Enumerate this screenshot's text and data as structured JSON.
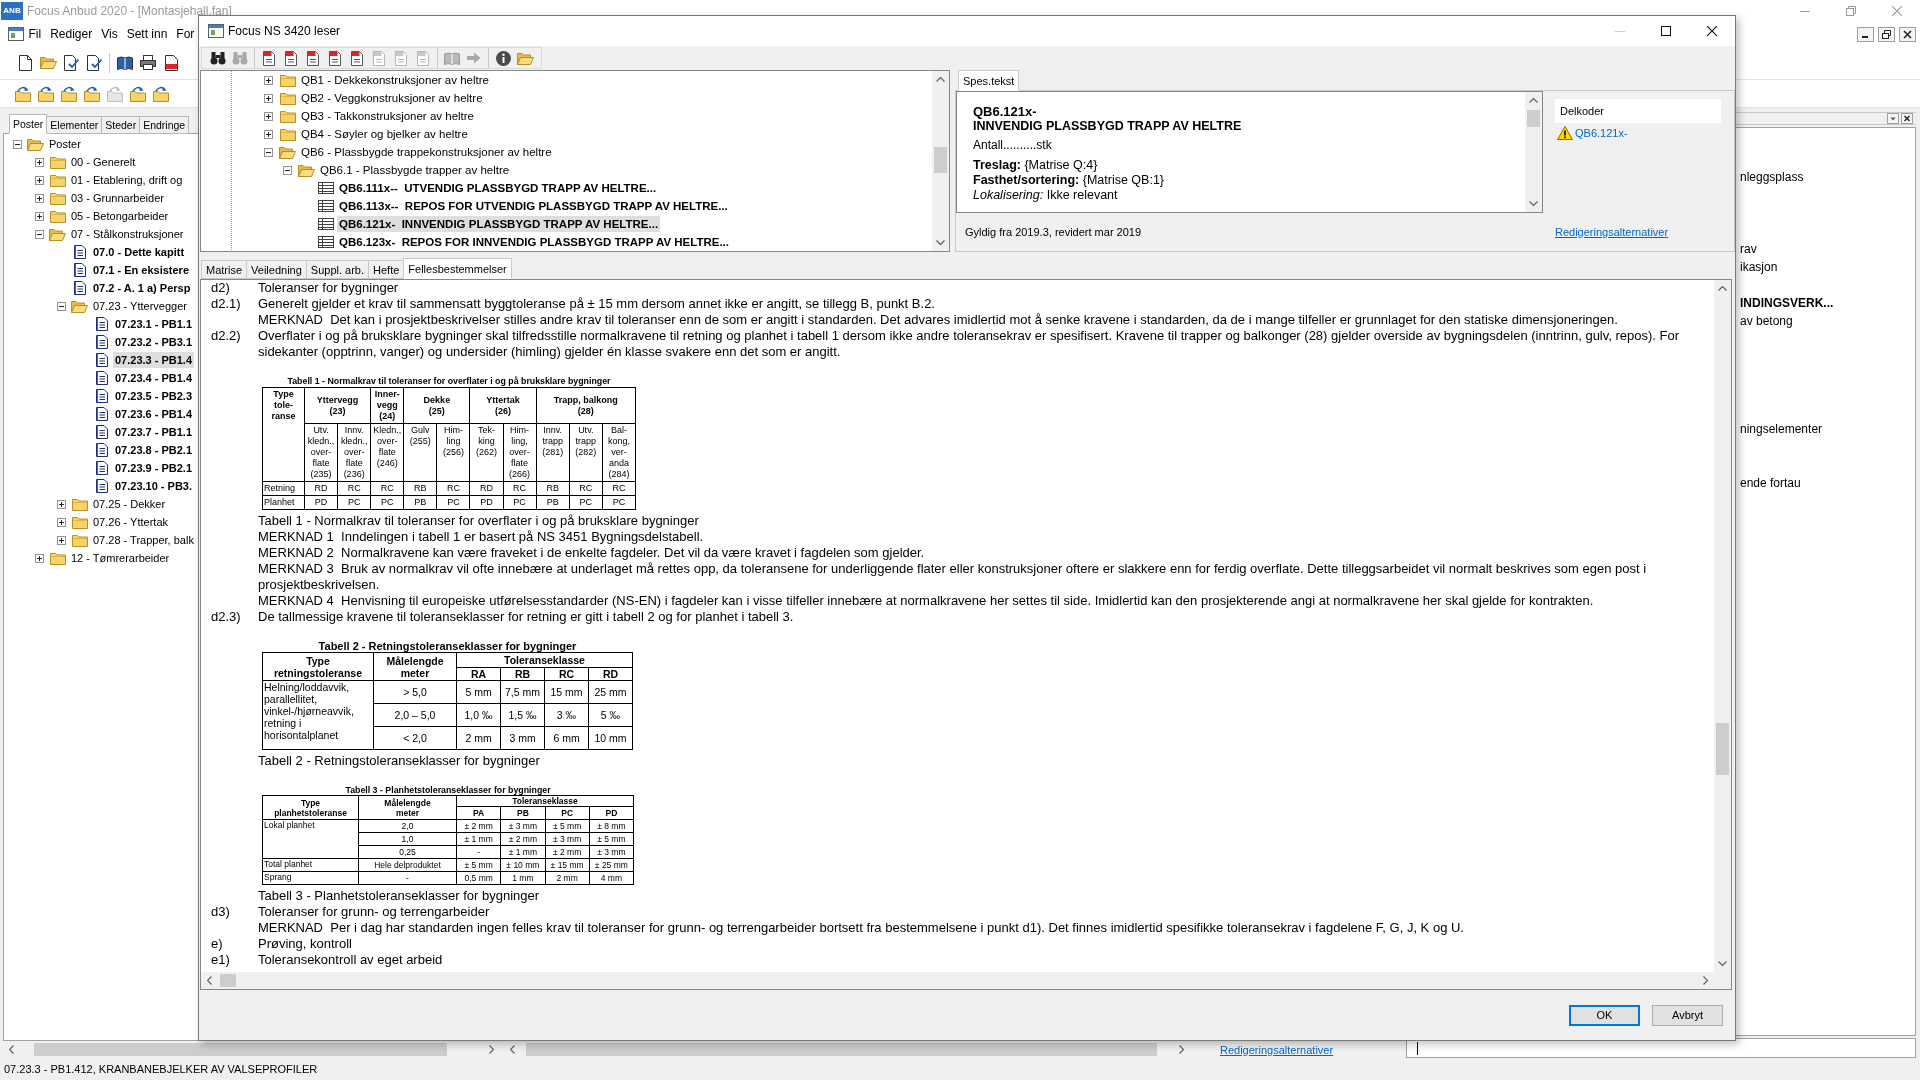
{
  "app": {
    "logo": "ANB",
    "title": "Focus Anbud 2020 - [Montasjehall.fan]",
    "menu": [
      "Fil",
      "Rediger",
      "Vis",
      "Sett inn",
      "For"
    ],
    "toolbars": [
      [
        [
          {
            "kind": "new",
            "disabled": false
          },
          {
            "kind": "open",
            "disabled": false
          },
          {
            "kind": "properties",
            "disabled": false
          },
          {
            "kind": "properties",
            "disabled": false
          }
        ],
        [
          {
            "kind": "book",
            "disabled": false
          },
          {
            "kind": "print",
            "disabled": false
          },
          {
            "kind": "pdf",
            "disabled": false
          }
        ]
      ],
      [
        [
          {
            "kind": "insert",
            "disabled": false
          },
          {
            "kind": "insert",
            "disabled": false
          },
          {
            "kind": "insert",
            "disabled": false
          },
          {
            "kind": "insert",
            "disabled": false
          },
          {
            "kind": "insert",
            "disabled": true
          },
          {
            "kind": "insert",
            "disabled": false
          },
          {
            "kind": "insert",
            "disabled": false
          }
        ]
      ]
    ],
    "panel_tabs": [
      {
        "label": "Poster",
        "selected": true
      },
      {
        "label": "Elementer",
        "selected": false
      },
      {
        "label": "Steder",
        "selected": false
      },
      {
        "label": "Endringe",
        "selected": false
      }
    ],
    "tree": [
      {
        "kind": "folder",
        "label": "Poster",
        "expanded": true,
        "selected": false,
        "children": [
          {
            "kind": "folder",
            "label": "00 - Generelt",
            "expanded": false,
            "selected": false
          },
          {
            "kind": "folder",
            "label": "01 - Etablering, drift og",
            "expanded": false,
            "selected": false
          },
          {
            "kind": "folder",
            "label": "03 - Grunnarbeider",
            "expanded": false,
            "selected": false
          },
          {
            "kind": "folder",
            "label": "05 - Betongarbeider",
            "expanded": false,
            "selected": false
          },
          {
            "kind": "folder",
            "label": "07 - Stålkonstruksjoner",
            "expanded": true,
            "selected": false,
            "children": [
              {
                "kind": "document",
                "label": "07.0 - Dette kapitt",
                "selected": false
              },
              {
                "kind": "document",
                "label": "07.1 - En eksistere",
                "selected": false
              },
              {
                "kind": "document",
                "label": "07.2 - A. 1 a) Persp",
                "selected": false
              },
              {
                "kind": "folder",
                "label": "07.23 - Yttervegger",
                "expanded": true,
                "selected": false,
                "children": [
                  {
                    "kind": "document",
                    "label": "07.23.1 - PB1.1",
                    "selected": false
                  },
                  {
                    "kind": "document",
                    "label": "07.23.2 - PB3.1",
                    "selected": false
                  },
                  {
                    "kind": "document",
                    "label": "07.23.3 - PB1.4",
                    "selected": true
                  },
                  {
                    "kind": "document",
                    "label": "07.23.4 - PB1.4",
                    "selected": false
                  },
                  {
                    "kind": "document",
                    "label": "07.23.5 - PB2.3",
                    "selected": false
                  },
                  {
                    "kind": "document",
                    "label": "07.23.6 - PB1.4",
                    "selected": false
                  },
                  {
                    "kind": "document",
                    "label": "07.23.7 - PB1.1",
                    "selected": false
                  },
                  {
                    "kind": "document",
                    "label": "07.23.8 - PB2.1",
                    "selected": false
                  },
                  {
                    "kind": "document",
                    "label": "07.23.9 - PB2.1",
                    "selected": false
                  },
                  {
                    "kind": "document",
                    "label": "07.23.10 - PB3.",
                    "selected": false
                  }
                ]
              },
              {
                "kind": "folder",
                "label": "07.25 - Dekker",
                "expanded": false,
                "selected": false
              },
              {
                "kind": "folder",
                "label": "07.26 - Yttertak",
                "expanded": false,
                "selected": false
              },
              {
                "kind": "folder",
                "label": "07.28 - Trapper, balk",
                "expanded": false,
                "selected": false
              }
            ]
          },
          {
            "kind": "folder",
            "label": "12 - Tømrerarbeider",
            "expanded": false,
            "selected": false
          }
        ]
      }
    ],
    "link": "Redigeringsalternativer",
    "side_list": [
      {
        "text": "nleggsplass",
        "bold": false
      },
      {
        "text": "rav",
        "bold": false
      },
      {
        "text": "ikasjon",
        "bold": false
      },
      {
        "text": "INDINGSVERK...",
        "bold": true
      },
      {
        "text": "av betong",
        "bold": false
      },
      {
        "text": "ningselementer",
        "bold": false
      },
      {
        "text": "ende fortau",
        "bold": false
      }
    ],
    "status_bar": "07.23.3 - PB1.412, KRANBANEBJELKER AV VALSEPROFILER"
  },
  "dialog": {
    "title": "Focus NS 3420 leser",
    "controls": [
      {
        "kind": "minimize",
        "disabled": true
      },
      {
        "kind": "maximize",
        "disabled": false
      },
      {
        "kind": "close",
        "disabled": false
      }
    ],
    "toolbar": [
      [
        {
          "kind": "find",
          "disabled": false
        },
        {
          "kind": "find",
          "disabled": true
        }
      ],
      [
        {
          "kind": "page",
          "disabled": false
        },
        {
          "kind": "page",
          "disabled": false
        },
        {
          "kind": "page",
          "disabled": false
        },
        {
          "kind": "page",
          "disabled": false
        },
        {
          "kind": "page",
          "disabled": false
        },
        {
          "kind": "page",
          "disabled": true
        },
        {
          "kind": "page",
          "disabled": true
        },
        {
          "kind": "page",
          "disabled": true
        }
      ],
      [
        {
          "kind": "book",
          "disabled": true
        },
        {
          "kind": "forward",
          "disabled": true
        }
      ],
      [
        {
          "kind": "info",
          "disabled": false
        },
        {
          "kind": "open",
          "disabled": false
        }
      ]
    ],
    "tree": [
      {
        "kind": "folder",
        "label": "QB1 - Dekkekonstruksjoner av heltre",
        "expanded": false,
        "selected": false
      },
      {
        "kind": "folder",
        "label": "QB2 - Veggkonstruksjoner av heltre",
        "expanded": false,
        "selected": false
      },
      {
        "kind": "folder",
        "label": "QB3 - Takkonstruksjoner av heltre",
        "expanded": false,
        "selected": false
      },
      {
        "kind": "folder",
        "label": "QB4 - Søyler og bjelker av heltre",
        "expanded": false,
        "selected": false
      },
      {
        "kind": "folder",
        "label": "QB6 - Plassbygde trappekonstruksjoner av heltre",
        "expanded": true,
        "selected": false,
        "children": [
          {
            "kind": "folder",
            "label": "QB6.1 - Plassbygde trapper av heltre",
            "expanded": true,
            "selected": false,
            "children": [
              {
                "kind": "entry",
                "label": "QB6.111x--  UTVENDIG PLASSBYGD TRAPP AV HELTRE...",
                "selected": false
              },
              {
                "kind": "entry",
                "label": "QB6.113x--  REPOS FOR UTVENDIG PLASSBYGD TRAPP AV HELTRE...",
                "selected": false
              },
              {
                "kind": "entry",
                "label": "QB6.121x-  INNVENDIG PLASSBYGD TRAPP AV HELTRE...",
                "selected": true
              },
              {
                "kind": "entry",
                "label": "QB6.123x-  REPOS FOR INNVENDIG PLASSBYGD TRAPP AV HELTRE...",
                "selected": false
              }
            ]
          }
        ]
      }
    ],
    "spec": {
      "tabs": [
        {
          "label": "Spes.tekst",
          "selected": true
        }
      ],
      "lines": [
        {
          "kind": "code",
          "text": "QB6.121x-"
        },
        {
          "kind": "heading",
          "text": "INNVENDIG PLASSBYGD TRAPP AV HELTRE"
        },
        {
          "kind": "text",
          "text": "Antall..........stk"
        },
        {
          "kind": "field",
          "text": "**Treslag:** {Matrise Q:4}"
        },
        {
          "kind": "field",
          "text": "**Fasthet/sortering:** {Matrise QB:1}"
        },
        {
          "kind": "field",
          "text": "*Lokalisering:* Ikke relevant"
        }
      ],
      "validity": "Gyldig fra 2019.3, revidert mar 2019",
      "link": "Redigeringsalternativer",
      "subcodes": {
        "title": "Delkoder",
        "items": [
          "QB6.121x-"
        ]
      }
    },
    "tabs": [
      {
        "label": "Matrise",
        "selected": false
      },
      {
        "label": "Veiledning",
        "selected": false
      },
      {
        "label": "Suppl. arb.",
        "selected": false
      },
      {
        "label": "Hefte",
        "selected": false
      },
      {
        "label": "Fellesbestemmelser",
        "selected": true
      }
    ],
    "content": [
      {
        "kind": "clause",
        "label": "d2)",
        "text": "Toleranser for bygninger"
      },
      {
        "kind": "clause",
        "label": "d2.1)",
        "text": "Generelt gjelder et krav til sammensatt byggtoleranse på ± 15 mm dersom annet ikke er angitt, se tillegg B, punkt B.2."
      },
      {
        "kind": "clause",
        "text": "MERKNAD  Det kan i prosjektbeskrivelser stilles andre krav til toleranser enn de som er angitt i standarden. Det advares imidlertid mot å senke kravene i standarden, da de i mange tilfeller er grunnlaget for den statiske dimensjoneringen."
      },
      {
        "kind": "clause",
        "label": "d2.2)",
        "text": "Overflater i og på bruksklare bygninger skal tilfredsstille normalkravene til retning og planhet i tabell 1 dersom ikke andre toleransekrav er spesifisert. Kravene til trapper og balkonger (28) gjelder overside av bygningsdelen (inntrinn, gulv, repos). For sidekanter (opptrinn, vanger) og undersider (himling) gjelder én klasse svakere enn det som er angitt."
      },
      {
        "kind": "matrix",
        "title": "Tabell 1 - Normalkrav til toleranser for overflater i og på bruksklare bygninger",
        "corner": "Type\ntole-\nranse",
        "groups": [
          {
            "label": "Yttervegg\n(23)",
            "columns": [
              "Utv.\nkledn.,\nover-\nflate\n(235)",
              "Innv.\nkledn.,\nover-\nflate\n(236)"
            ]
          },
          {
            "label": "Inner-\nvegg\n(24)",
            "columns": [
              "Kledn.,\nover-\nflate\n(246)"
            ]
          },
          {
            "label": "Dekke\n(25)",
            "columns": [
              "Gulv\n(255)",
              "Him-\nling\n(256)"
            ]
          },
          {
            "label": "Yttertak\n(26)",
            "columns": [
              "Tek-\nking\n(262)",
              "Him-\nling,\nover-\nflate\n(266)"
            ]
          },
          {
            "label": "Trapp, balkong\n(28)",
            "columns": [
              "Innv.\ntrapp\n(281)",
              "Utv.\ntrapp\n(282)",
              "Bal-\nkong,\nver-\nanda\n(284)"
            ]
          }
        ],
        "rows": [
          {
            "label": "Retning",
            "cells": [
              "RD",
              "RC",
              "RC",
              "RB",
              "RC",
              "RD",
              "RC",
              "RB",
              "RC",
              "RC"
            ]
          },
          {
            "label": "Planhet",
            "cells": [
              "PD",
              "PC",
              "PC",
              "PB",
              "PC",
              "PD",
              "PC",
              "PB",
              "PC",
              "PC"
            ]
          }
        ]
      },
      {
        "kind": "clause",
        "text": "Tabell 1 - Normalkrav til toleranser for overflater i og på bruksklare bygninger"
      },
      {
        "kind": "clause",
        "text": "MERKNAD 1  Inndelingen i tabell 1 er basert på NS 3451 Bygningsdelstabell."
      },
      {
        "kind": "clause",
        "text": "MERKNAD 2  Normalkravene kan være fraveket i de enkelte fagdeler. Det vil da være kravet i fagdelen som gjelder."
      },
      {
        "kind": "clause",
        "text": "MERKNAD 3  Bruk av normalkrav vil ofte innebære at underlaget må rettes opp, da toleransene for underliggende flater eller konstruksjoner oftere er slakkere enn for ferdig overflate. Dette tilleggsarbeidet vil normalt beskrives som egen post i prosjektbeskrivelsen."
      },
      {
        "kind": "clause",
        "text": "MERKNAD 4  Henvisning til europeiske utførelsesstandarder (NS-EN) i fagdeler kan i visse tilfeller innebære at normalkravene her settes til side. Imidlertid kan den prosjekterende angi at normalkravene her skal gjelde for kontrakten."
      },
      {
        "kind": "clause",
        "label": "d2.3)",
        "text": "De tallmessige kravene til toleranseklasser for retning er gitt i tabell 2 og for planhet i tabell 3."
      },
      {
        "kind": "classes",
        "title": "Tabell 2 - Retningstoleranseklasser for bygninger",
        "head": [
          "Type\nretningstoleranse",
          "Målelengde\nmeter"
        ],
        "group": {
          "label": "Toleranseklasse",
          "columns": [
            "RA",
            "RB",
            "RC",
            "RD"
          ]
        },
        "sections": [
          {
            "type": "Helning/loddavvik,\nparallellitet,\nvinkel-/hjørneavvik,\nretning i\nhorisontalplanet",
            "rows": [
              {
                "length": "> 5,0",
                "cells": [
                  "5 mm",
                  "7,5 mm",
                  "15 mm",
                  "25 mm"
                ]
              },
              {
                "length": "2,0 – 5,0",
                "cells": [
                  "1,0 ‰",
                  "1,5 ‰",
                  "3 ‰",
                  "5 ‰"
                ]
              },
              {
                "length": "< 2,0",
                "cells": [
                  "2 mm",
                  "3 mm",
                  "6 mm",
                  "10 mm"
                ]
              }
            ]
          }
        ]
      },
      {
        "kind": "clause",
        "text": "Tabell 2 - Retningstoleranseklasser for bygninger"
      },
      {
        "kind": "compact",
        "title": "Tabell 3 - Planhetstoleranseklasser for bygninger",
        "head": [
          "Type\nplanhetstoleranse",
          "Målelengde\nmeter"
        ],
        "group": {
          "label": "Toleranseklasse",
          "columns": [
            "PA",
            "PB",
            "PC",
            "PD"
          ]
        },
        "sections": [
          {
            "type": "Lokal planhet",
            "rows": [
              {
                "length": "2,0",
                "cells": [
                  "± 2 mm",
                  "± 3 mm",
                  "± 5 mm",
                  "± 8 mm"
                ]
              },
              {
                "length": "1,0",
                "cells": [
                  "± 1 mm",
                  "± 2 mm",
                  "± 3 mm",
                  "± 5 mm"
                ]
              },
              {
                "length": "0,25",
                "cells": [
                  "-",
                  "± 1 mm",
                  "± 2 mm",
                  "± 3 mm"
                ]
              }
            ]
          },
          {
            "type": "Total planhet",
            "rows": [
              {
                "length": "Hele delproduktet",
                "cells": [
                  "± 5 mm",
                  "± 10 mm",
                  "± 15 mm",
                  "± 25 mm"
                ]
              }
            ]
          },
          {
            "type": "Sprang",
            "rows": [
              {
                "length": "-",
                "cells": [
                  "0,5 mm",
                  "1 mm",
                  "2 mm",
                  "4 mm"
                ]
              }
            ]
          }
        ]
      },
      {
        "kind": "clause",
        "text": "Tabell 3 - Planhetstoleranseklasser for bygninger"
      },
      {
        "kind": "clause",
        "label": "d3)",
        "text": "Toleranser for grunn- og terrengarbeider"
      },
      {
        "kind": "clause",
        "text": "MERKNAD  Per i dag har standarden ingen felles krav til toleranser for grunn- og terrengarbeider bortsett fra bestemmelsene i punkt d1). Det finnes imidlertid spesifikke toleransekrav i fagdelene F, G, J, K og U."
      },
      {
        "kind": "clause",
        "label": "e)",
        "text": "Prøving, kontroll"
      },
      {
        "kind": "clause",
        "label": "e1)",
        "text": "Toleransekontroll av eget arbeid"
      }
    ],
    "buttons": [
      {
        "label": "OK",
        "default": true
      },
      {
        "label": "Avbryt",
        "default": false
      }
    ]
  }
}
